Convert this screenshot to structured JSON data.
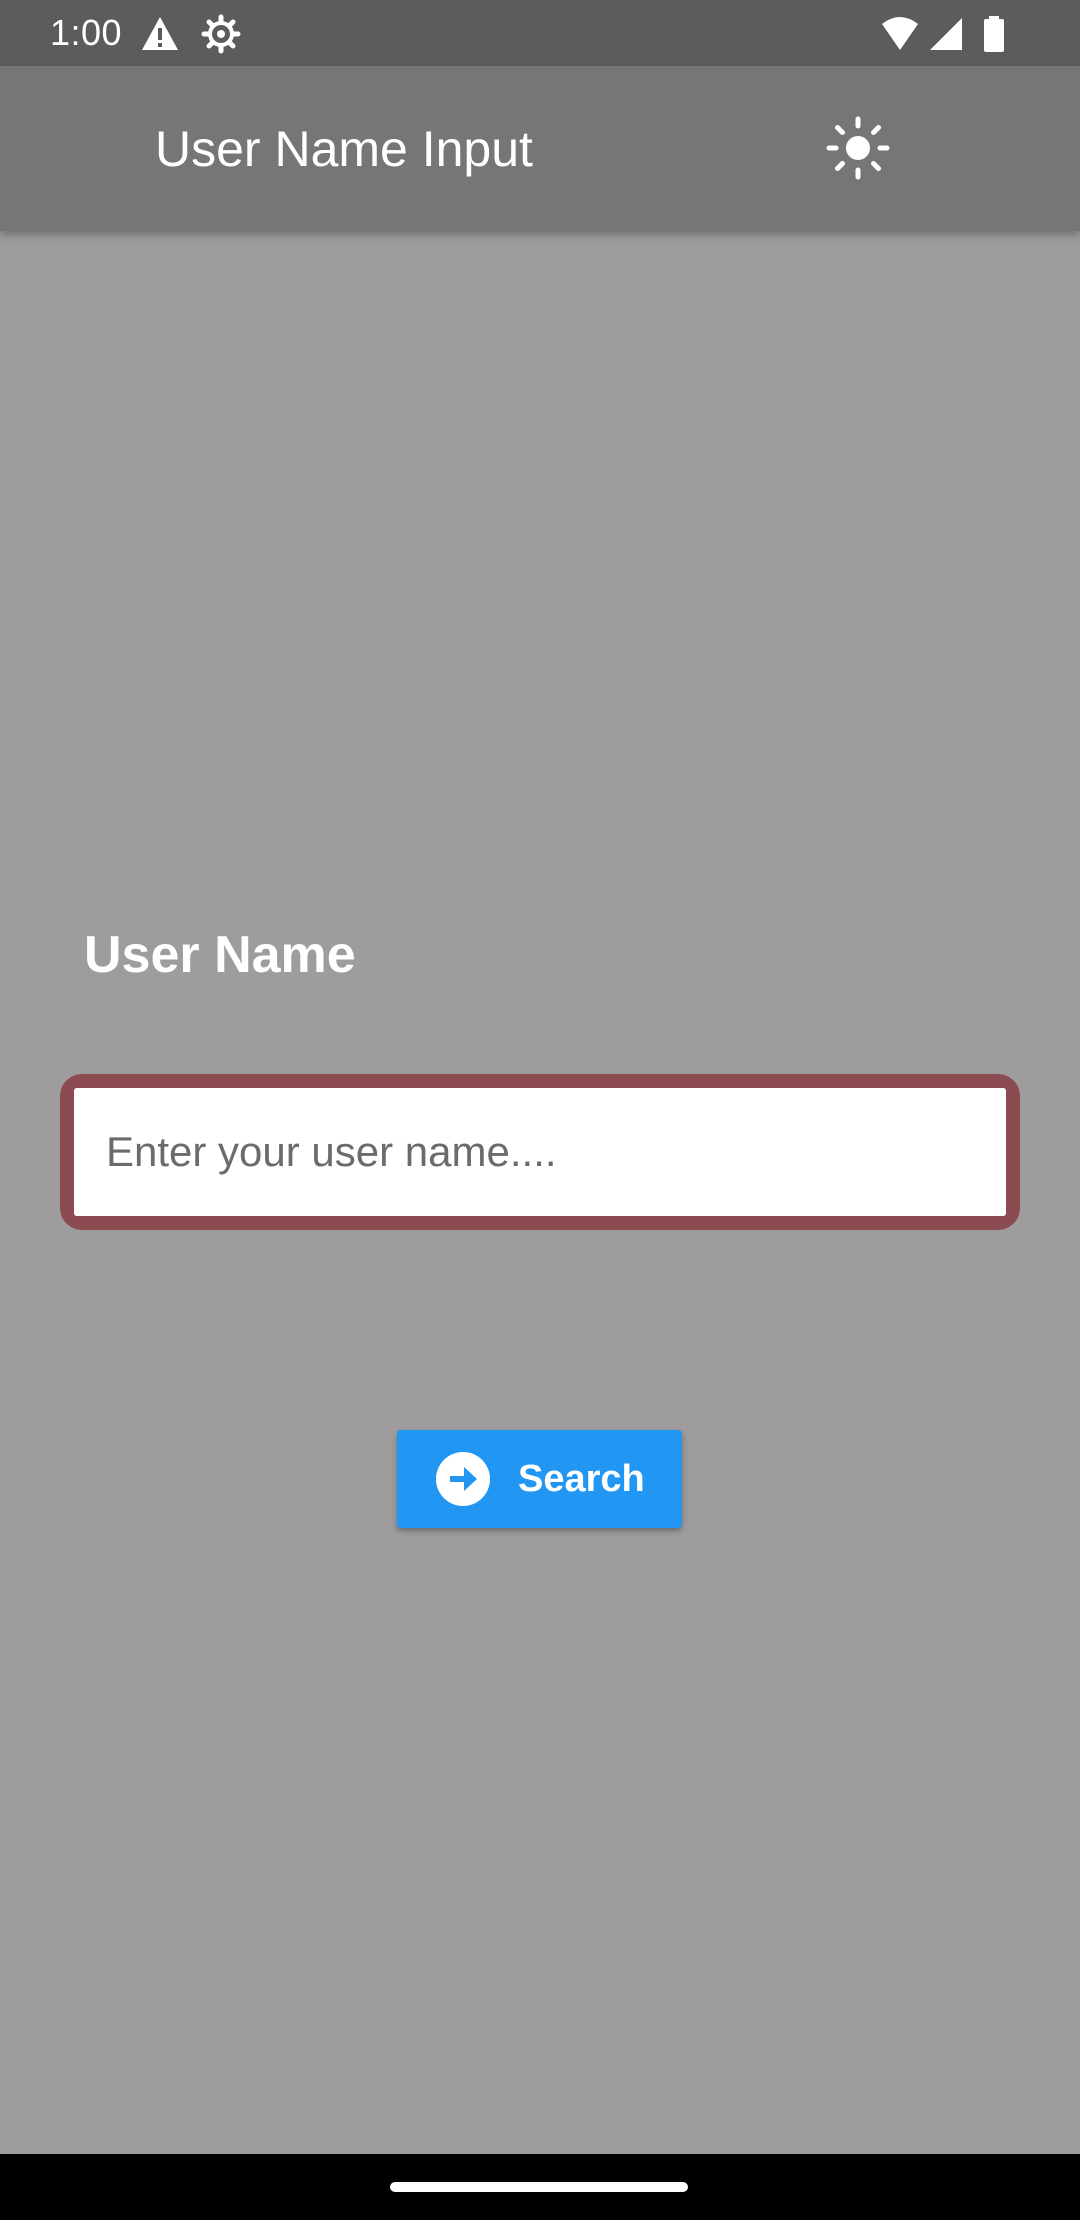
{
  "status_bar": {
    "time": "1:00",
    "icons": [
      "warning-icon",
      "settings-icon",
      "wifi-icon",
      "signal-icon",
      "battery-icon"
    ]
  },
  "app_bar": {
    "title": "User Name Input",
    "action_icon": "sun-icon"
  },
  "form": {
    "label": "User Name",
    "input": {
      "value": "",
      "placeholder": "Enter your user name...."
    },
    "button": {
      "label": "Search",
      "icon": "arrow-right-circle-icon"
    }
  },
  "colors": {
    "background": "#9e9c9d",
    "status_bar": "#5c5c5c",
    "app_bar": "#767676",
    "input_border": "#8c4b50",
    "button": "#2196f3"
  }
}
